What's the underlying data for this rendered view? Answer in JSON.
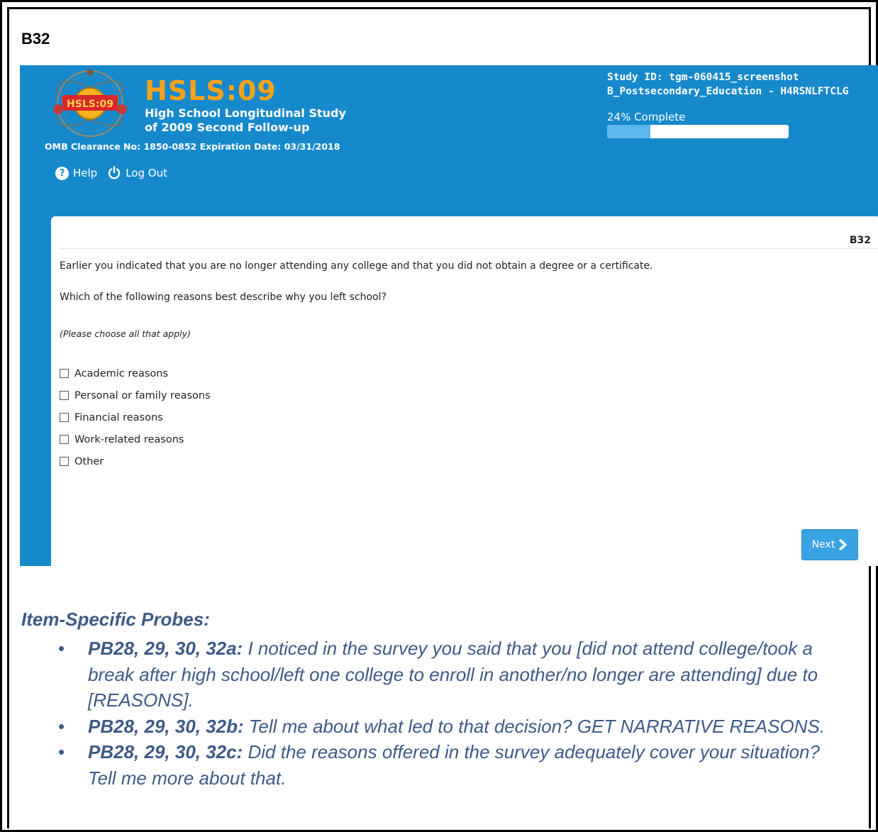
{
  "doc_label": "B32",
  "header": {
    "logo_text": "HSLS:09",
    "title": "HSLS:09",
    "subtitle_line1": "High School Longitudinal Study",
    "subtitle_line2": "of 2009 Second Follow-up",
    "omb": "OMB Clearance No: 1850-0852 Expiration Date: 03/31/2018",
    "study_id": "Study ID: tgm-060415_screenshot",
    "section": "B_Postsecondary_Education - H4RSNLFTCLG",
    "progress_label": "24% Complete",
    "progress_fraction": 0.24,
    "help_label": "Help",
    "logout_label": "Log Out"
  },
  "question": {
    "code": "B32",
    "intro": "Earlier you indicated that you are no longer attending any college and that you did not obtain a degree or a certificate.",
    "prompt": "Which of the following reasons best describe why you left school?",
    "note": "(Please choose all that apply)",
    "options": [
      "Academic reasons",
      "Personal or family reasons",
      "Financial reasons",
      "Work-related reasons",
      "Other"
    ],
    "next_label": "Next"
  },
  "probes": {
    "title": "Item-Specific Probes:",
    "items": [
      {
        "label": "PB28, 29, 30, 32a:",
        "text": " I noticed in the survey you said that you [did not attend college/took a break after high school/left one college to enroll in another/no longer are attending] due to [REASONS]."
      },
      {
        "label": "PB28, 29, 30, 32b:",
        "text": " Tell me about what led to that decision?  GET NARRATIVE REASONS."
      },
      {
        "label": "PB28, 29, 30, 32c:",
        "text": " Did the reasons offered in the survey adequately cover your situation?  Tell me more about that."
      }
    ]
  }
}
